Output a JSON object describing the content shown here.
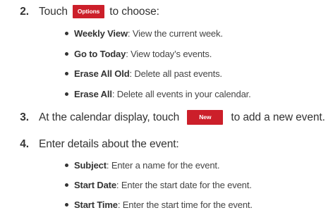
{
  "steps": [
    {
      "num": "2.",
      "before": "Touch",
      "button": "Options",
      "after": "to choose:"
    },
    {
      "num": "3.",
      "before": "At the calendar display, touch",
      "button": "New",
      "after": "to add a new event."
    },
    {
      "num": "4.",
      "text": "Enter details about the event:"
    }
  ],
  "options_bullets": [
    {
      "term": "Weekly View",
      "desc": ": View the current week."
    },
    {
      "term": "Go to Today",
      "desc": ": View today’s events."
    },
    {
      "term": "Erase All Old",
      "desc": ": Delete all past events."
    },
    {
      "term": "Erase All",
      "desc": ": Delete all events in your calendar."
    }
  ],
  "detail_bullets": [
    {
      "term": "Subject",
      "desc": ": Enter a name for the event."
    },
    {
      "term": "Start Date",
      "desc": ": Enter the start date for the event."
    },
    {
      "term": "Start Time",
      "desc": ": Enter the start time for the event."
    }
  ],
  "colors": {
    "button_bg": "#cc1f2a",
    "button_text": "#ffffff",
    "text": "#333333"
  }
}
